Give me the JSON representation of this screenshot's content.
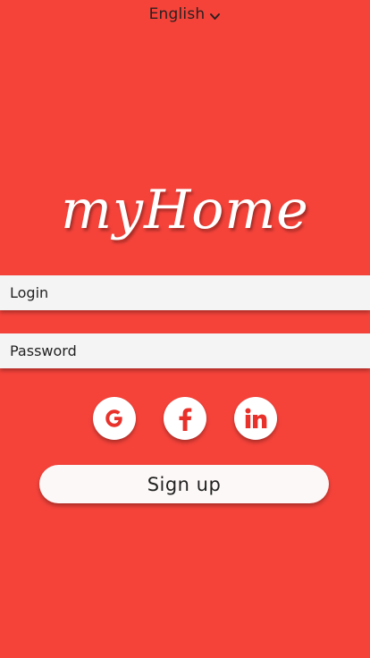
{
  "language": {
    "selected": "English",
    "icon": "chevron-down-icon"
  },
  "brand": {
    "logo_text": "myHome"
  },
  "form": {
    "login_placeholder": "Login",
    "password_placeholder": "Password"
  },
  "social": {
    "google_icon": "google-icon",
    "facebook_icon": "facebook-icon",
    "linkedin_icon": "linkedin-icon"
  },
  "actions": {
    "signup_label": "Sign up"
  },
  "colors": {
    "background": "#F5433A",
    "accent": "#E8312A",
    "field_bg": "#F4F4F4",
    "button_bg": "#FCF8F7"
  }
}
